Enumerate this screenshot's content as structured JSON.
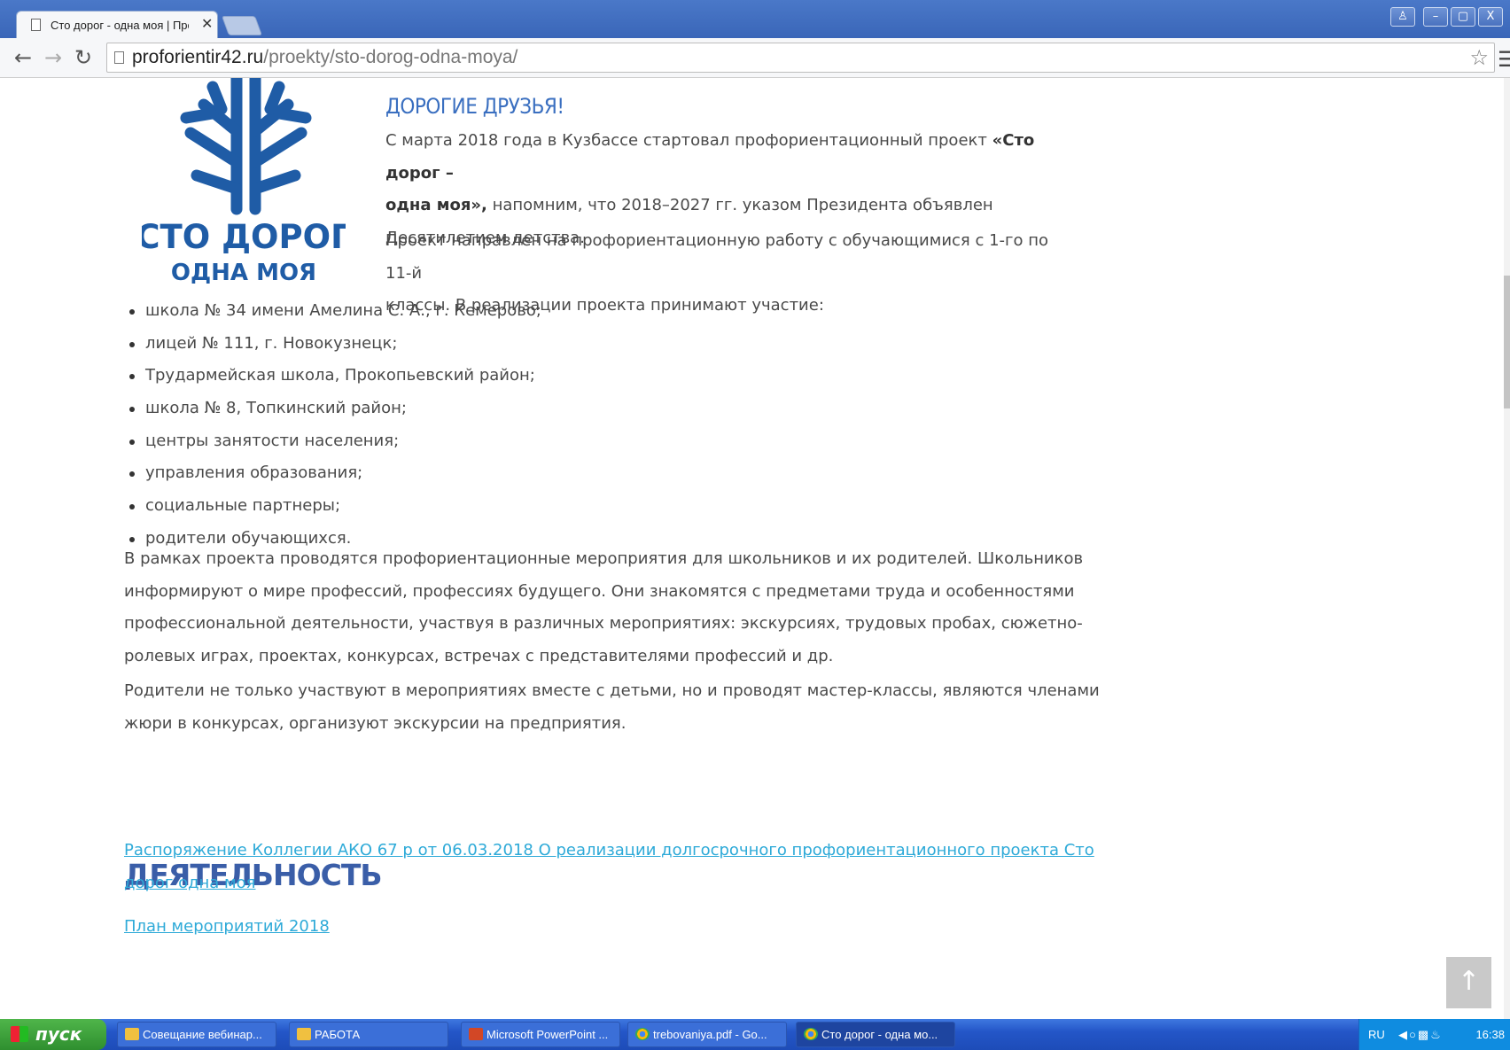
{
  "browser": {
    "tab_title": "Сто дорог - одна моя | Про",
    "tab_close": "✕",
    "url_host": "proforientir42.ru",
    "url_path": "/proekty/sto-dorog-odna-moya/",
    "window_buttons": [
      "♙",
      "–",
      "▢",
      "X"
    ]
  },
  "logo": {
    "line1": "СТО ДОРОГ",
    "line2": "ОДНА МОЯ"
  },
  "article": {
    "heading": "ДОРОГИЕ ДРУЗЬЯ!",
    "intro_line1_a": "С марта  2018 года в Кузбассе стартовал профориентационный проект ",
    "intro_line1_b": "«Сто дорог –",
    "intro_line2_a": "одна моя»,",
    "intro_line2_b": " напомним, что 2018–2027  гг. указом Президента объявлен",
    "intro_line3": "Десятилетием детства.",
    "project_line1": "Проект направлен на профориентационную работу с обучающимися с 1-го по 11-й",
    "project_line2": "классы. В реализации проекта принимают участие:",
    "participants": [
      "школа № 34 имени Амелина С. А., г. Кемерово;",
      "лицей № 111, г. Новокузнецк;",
      "Трудармейская школа, Прокопьевский район;",
      "школа № 8, Топкинский район;",
      "центры занятости населения;",
      "управления образования;",
      "социальные партнеры;",
      "родители обучающихся."
    ],
    "para1": [
      "В рамках проекта проводятся профориентационные мероприятия для школьников и их родителей. Школьников",
      "информируют о мире  профессий, профессиях будущего. Они знакомятся с предметами труда и особенностями",
      "профессиональной деятельности, участвуя в различных мероприятиях: экскурсиях, трудовых пробах, сюжетно-",
      "ролевых играх, проектах, конкурсах, встречах с представителями профессий и др."
    ],
    "para2": [
      "Родители не только участвуют в мероприятиях вместе с детьми, но и проводят мастер-классы, являются членами",
      "жюри в конкурсах, организуют экскурсии на предприятия."
    ],
    "activity_heading": "ДЕЯТЕЛЬНОСТЬ",
    "link1_line1": "Распоряжение Коллегии АКО 67 р от 06.03.2018 О реализации долгосрочного профориентационного проекта Сто",
    "link1_line2": "дорог одна моя",
    "link2": "План мероприятий 2018",
    "up_button": "↑"
  },
  "taskbar": {
    "start_label": "пуск",
    "tasks": [
      "Совещание вебинар...",
      "РАБОТА",
      "Microsoft PowerPoint ...",
      "trebovaniya.pdf - Go...",
      "Сто дорог - одна мо..."
    ],
    "lang": "RU",
    "clock": "16:38"
  },
  "colors": {
    "heading_blue": "#3a6fc0",
    "activity_blue": "#3a5ea8",
    "link_cyan": "#2eaad8",
    "logo_blue": "#1f5ca6"
  },
  "icons": {
    "tab": "document-icon",
    "back": "back-arrow-icon",
    "forward": "forward-arrow-icon",
    "reload": "reload-icon",
    "bookmark": "star-icon",
    "menu": "hamburger-menu-icon",
    "scroll_top": "arrow-up-icon"
  }
}
